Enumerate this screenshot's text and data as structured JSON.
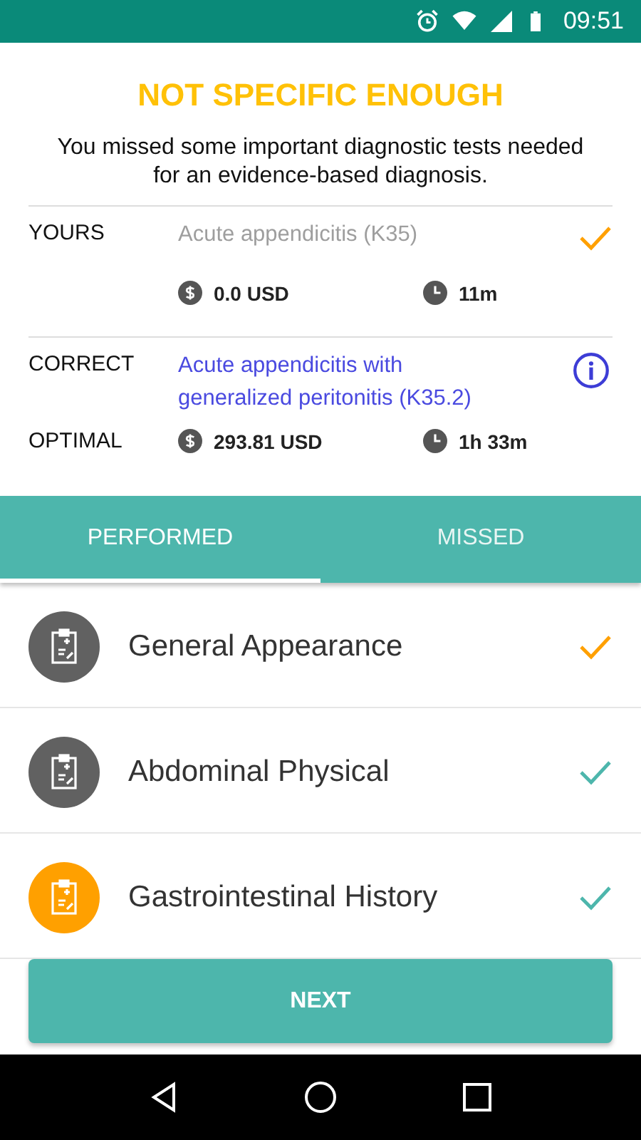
{
  "status_bar": {
    "time": "09:51"
  },
  "result": {
    "title": "NOT SPECIFIC ENOUGH",
    "message": "You missed some important diagnostic tests needed for an evidence-based diagnosis."
  },
  "yours": {
    "label": "YOURS",
    "diagnosis": "Acute appendicitis (K35)",
    "check": {
      "color": "#ffa000"
    },
    "cost": "0.0 USD",
    "time": "11m"
  },
  "correct": {
    "label": "CORRECT",
    "diagnosis": "Acute appendicitis with generalized peritonitis (K35.2)"
  },
  "optimal": {
    "label": "OPTIMAL",
    "cost": "293.81 USD",
    "time": "1h 33m"
  },
  "tabs": [
    {
      "label": "PERFORMED",
      "selected": true
    },
    {
      "label": "MISSED",
      "selected": false
    }
  ],
  "tests": [
    {
      "name": "General Appearance",
      "color": "#616161",
      "check": {
        "color": "#ffa000"
      }
    },
    {
      "name": "Abdominal Physical",
      "color": "#616161",
      "check": {
        "color": "#4db6ac"
      }
    },
    {
      "name": "Gastrointestinal History",
      "color": "#ffa000",
      "check": {
        "color": "#4db6ac"
      }
    }
  ],
  "button": {
    "label": "NEXT"
  }
}
